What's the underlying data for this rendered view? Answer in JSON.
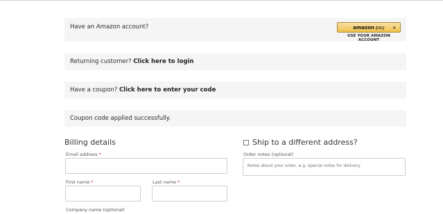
{
  "notices": {
    "amazon_text": "Have an Amazon account?",
    "amazon_button": {
      "brand": "amazon",
      "pay": "pay",
      "chevron": "»",
      "caption": "USE YOUR AMAZON ACCOUNT"
    },
    "returning_prefix": "Returning customer?",
    "returning_link": "Click here to login",
    "coupon_prefix": "Have a coupon?",
    "coupon_link": "Click here to enter your code",
    "coupon_success": "Coupon code applied successfully."
  },
  "billing": {
    "heading": "Billing details",
    "email_label": "Email address",
    "first_name_label": "First name",
    "last_name_label": "Last name",
    "company_label": "Company name (optional)",
    "required_marker": "*"
  },
  "shipping": {
    "heading": "Ship to a different address?",
    "notes_label": "Order notes (optional)",
    "notes_placeholder": "Notes about your order, e.g. special notes for delivery."
  }
}
